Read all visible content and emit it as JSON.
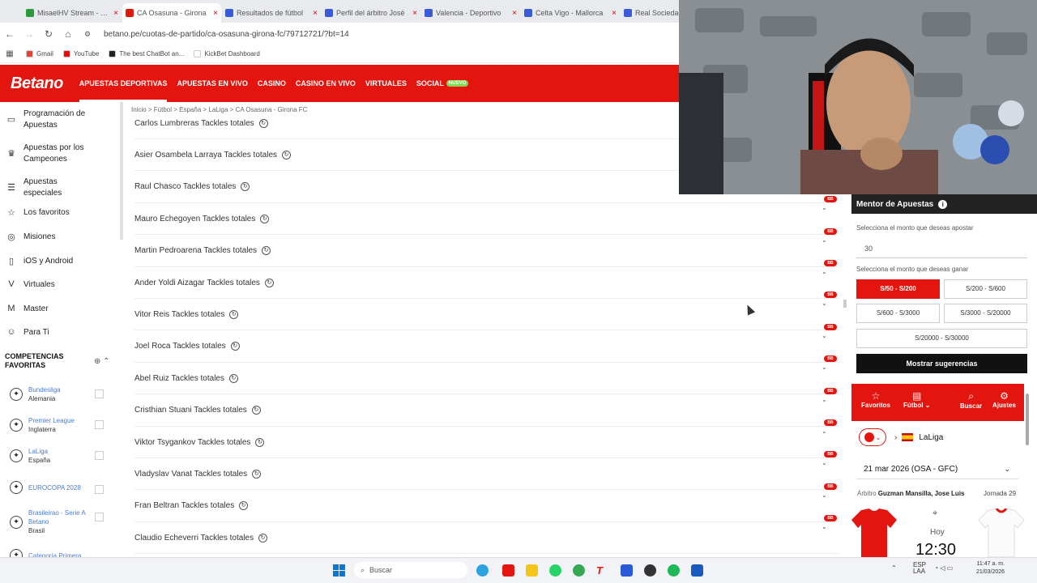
{
  "browser": {
    "tabs": [
      {
        "label": "MisaelHV Stream - …",
        "color": "#2a9d3a",
        "active": false
      },
      {
        "label": "CA Osasuna - Girona",
        "color": "#e4150f",
        "active": true
      },
      {
        "label": "Resultados de fútbol",
        "color": "#3a5bd9",
        "active": false
      },
      {
        "label": "Perfil del árbitro José",
        "color": "#3a5bd9",
        "active": false
      },
      {
        "label": "Valencia - Deportivo",
        "color": "#3a5bd9",
        "active": false
      },
      {
        "label": "Celta Vigo - Mallorca",
        "color": "#3a5bd9",
        "active": false
      },
      {
        "label": "Real Sociedad",
        "color": "#3a5bd9",
        "active": false
      }
    ],
    "url": "betano.pe/cuotas-de-partido/ca-osasuna-girona-fc/79712721/?bt=14",
    "bookmarks": [
      {
        "label": "Gmail",
        "color": "#ea4335"
      },
      {
        "label": "YouTube",
        "color": "#ff0000"
      },
      {
        "label": "The best ChatBot an...",
        "color": "#222222"
      },
      {
        "label": "KickBet Dashboard",
        "color": "#ffffff"
      }
    ]
  },
  "header": {
    "logo": "Betano",
    "nav": [
      "APUESTAS DEPORTIVAS",
      "APUESTAS EN VIVO",
      "CASINO",
      "CASINO EN VIVO",
      "VIRTUALES",
      "SOCIAL"
    ],
    "nuevo": "NUEVO",
    "brand_color": "#e4150f"
  },
  "sidebar": {
    "items": [
      {
        "label": "Programación de Apuestas",
        "icon": "calendar-icon"
      },
      {
        "label": "Apuestas por los Campeones",
        "icon": "trophy-icon"
      },
      {
        "label": "Apuestas especiales",
        "icon": "list-icon"
      },
      {
        "label": "Los favoritos",
        "icon": "star-icon"
      },
      {
        "label": "Misiones",
        "icon": "target-icon"
      },
      {
        "label": "iOS y Android",
        "icon": "phone-icon"
      },
      {
        "label": "Virtuales",
        "icon": "virtual-icon"
      },
      {
        "label": "Master",
        "icon": "master-icon"
      },
      {
        "label": "Para Ti",
        "icon": "user-icon"
      }
    ],
    "competitions_title": "COMPETENCIAS FAVORITAS",
    "competitions": [
      {
        "name": "Bundesliga",
        "country": "Alemania"
      },
      {
        "name": "Premier League",
        "country": "Inglaterra"
      },
      {
        "name": "LaLiga",
        "country": "España"
      },
      {
        "name": "EUROCOPA 2028",
        "country": ""
      },
      {
        "name": "Brasileirao - Serie A Betano",
        "country": "Brasil"
      },
      {
        "name": "Categoría Primera",
        "country": ""
      }
    ]
  },
  "main": {
    "breadcrumb": "Inicio > Fútbol > España > LaLiga > CA Osasuna - Girona FC",
    "badge": "BB",
    "rows": [
      "Carlos Lumbreras Tackles totales",
      "Asier Osambela Larraya Tackles totales",
      "Raul Chasco Tackles totales",
      "Mauro Echegoyen Tackles totales",
      "Martin Pedroarena Tackles totales",
      "Ander Yoldi Aizagar Tackles totales",
      "Vitor Reis Tackles totales",
      "Joel Roca Tackles totales",
      "Abel Ruiz Tackles totales",
      "Cristhian Stuani Tackles totales",
      "Viktor Tsygankov Tackles totales",
      "Vladyslav Vanat Tackles totales",
      "Fran Beltran Tackles totales",
      "Claudio Echeverri Tackles totales"
    ]
  },
  "mentor": {
    "title": "Mentor de Apuestas",
    "stake_label": "Selecciona el monto que deseas apostar",
    "stake_value": "30",
    "win_label": "Selecciona el monto que deseas ganar",
    "options": [
      "S/50 - S/200",
      "S/200 - S/600",
      "S/600 - S/3000",
      "S/3000 - S/20000",
      "S/20000 - S/30000"
    ],
    "selected_option": 0,
    "suggest_button": "Mostrar sugerencias"
  },
  "widget": {
    "favoritos": "Favoritos",
    "futbol": "Fútbol",
    "buscar": "Buscar",
    "ajustes": "Ajustes",
    "league": "LaLiga",
    "date": "21 mar 2026 (OSA - GFC)",
    "referee_label": "Árbitro",
    "referee_name": "Guzman Mansilla, Jose Luis",
    "jornada": "Jornada 29",
    "hoy": "Hoy",
    "time": "12:30"
  },
  "taskbar": {
    "search": "Buscar",
    "lang": "ESP",
    "lang2": "LAA",
    "clock_time": "11:47 a. m.",
    "clock_date": "21/03/2026"
  }
}
